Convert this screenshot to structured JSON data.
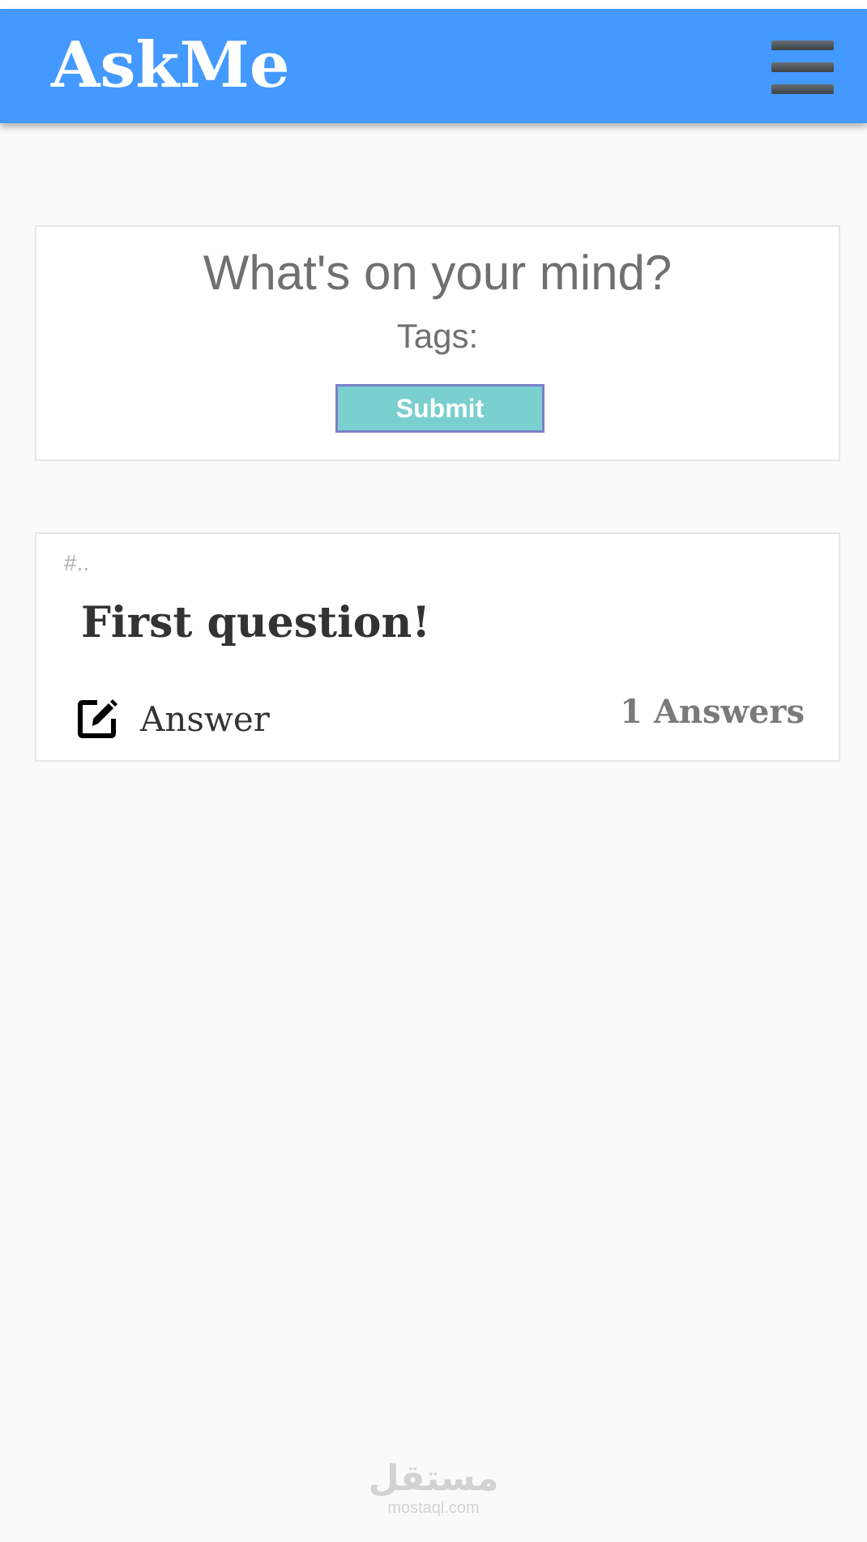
{
  "header": {
    "brand": "AskMe",
    "menu_icon": "hamburger-menu-icon",
    "color": "#4499ff"
  },
  "ask_form": {
    "prompt": "What's on your mind?",
    "tags_label": "Tags:",
    "submit_label": "Submit",
    "submit_color": "#7acfcf"
  },
  "questions": [
    {
      "tag": "#..",
      "title": "First question!",
      "answer_label": "Answer",
      "answer_icon": "edit-icon",
      "answers_count": "1 Answers"
    }
  ],
  "watermark": {
    "arabic": "مستقل",
    "latin": "mostaql.com"
  }
}
